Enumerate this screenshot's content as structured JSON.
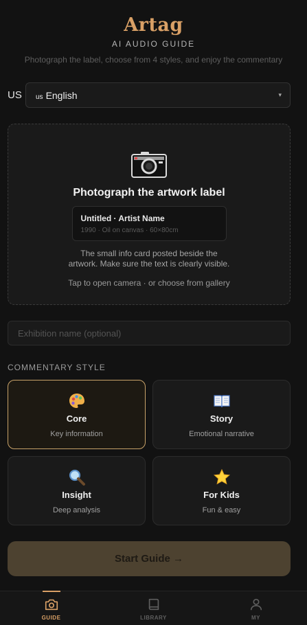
{
  "app": {
    "title": "Artag",
    "subtitle": "AI AUDIO GUIDE",
    "tagline": "Photograph the label, choose from 4 styles, and enjoy the commentary"
  },
  "language": {
    "code_label": "US",
    "flag": "us",
    "selected": "English"
  },
  "upload": {
    "title": "Photograph the artwork label",
    "sample_title": "Untitled · Artist Name",
    "sample_meta": "1990 · Oil on canvas · 60×80cm",
    "description": "The small info card posted beside the artwork. Make sure the text is clearly visible.",
    "hint": "Tap to open camera · or choose from gallery"
  },
  "exhibition": {
    "placeholder": "Exhibition name (optional)",
    "value": ""
  },
  "commentary": {
    "section_label": "COMMENTARY STYLE",
    "styles": [
      {
        "name": "Core",
        "desc": "Key information",
        "icon": "palette-icon",
        "selected": true
      },
      {
        "name": "Story",
        "desc": "Emotional narrative",
        "icon": "book-icon",
        "selected": false
      },
      {
        "name": "Insight",
        "desc": "Deep analysis",
        "icon": "magnifier-icon",
        "selected": false
      },
      {
        "name": "For Kids",
        "desc": "Fun & easy",
        "icon": "star-icon",
        "selected": false
      }
    ]
  },
  "start_button": {
    "label": "Start Guide →"
  },
  "tabs": [
    {
      "label": "GUIDE",
      "icon": "camera-icon",
      "active": true
    },
    {
      "label": "LIBRARY",
      "icon": "book-icon",
      "active": false
    },
    {
      "label": "MY",
      "icon": "user-icon",
      "active": false
    }
  ],
  "colors": {
    "accent": "#d9a066",
    "background": "#121212",
    "card": "#1a1a1a",
    "button": "#4d4230"
  }
}
